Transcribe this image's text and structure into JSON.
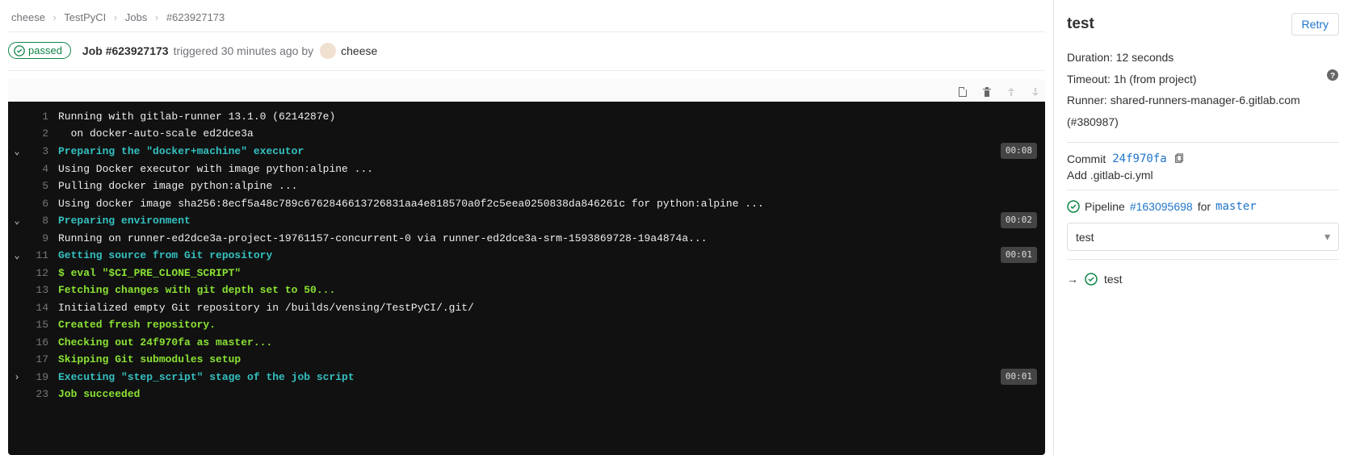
{
  "breadcrumb": {
    "items": [
      {
        "label": "cheese"
      },
      {
        "label": "TestPyCI"
      },
      {
        "label": "Jobs"
      },
      {
        "label": "#623927173"
      }
    ]
  },
  "header": {
    "status": "passed",
    "job_label": "Job #623927173",
    "triggered": "triggered 30 minutes ago by",
    "user": "cheese"
  },
  "log": {
    "lines": [
      {
        "n": 1,
        "color": "white",
        "text": "Running with gitlab-runner 13.1.0 (6214287e)"
      },
      {
        "n": 2,
        "color": "white",
        "text": "  on docker-auto-scale ed2dce3a"
      },
      {
        "n": 3,
        "color": "teal",
        "text": "Preparing the \"docker+machine\" executor",
        "chev": "down",
        "dur": "00:08"
      },
      {
        "n": 4,
        "color": "white",
        "text": "Using Docker executor with image python:alpine ..."
      },
      {
        "n": 5,
        "color": "white",
        "text": "Pulling docker image python:alpine ..."
      },
      {
        "n": 6,
        "color": "white",
        "text": "Using docker image sha256:8ecf5a48c789c6762846613726831aa4e818570a0f2c5eea0250838da846261c for python:alpine ..."
      },
      {
        "n": 8,
        "color": "teal",
        "text": "Preparing environment",
        "chev": "down",
        "dur": "00:02"
      },
      {
        "n": 9,
        "color": "white",
        "text": "Running on runner-ed2dce3a-project-19761157-concurrent-0 via runner-ed2dce3a-srm-1593869728-19a4874a..."
      },
      {
        "n": 11,
        "color": "teal",
        "text": "Getting source from Git repository",
        "chev": "down",
        "dur": "00:01"
      },
      {
        "n": 12,
        "color": "lime",
        "text": "$ eval \"$CI_PRE_CLONE_SCRIPT\""
      },
      {
        "n": 13,
        "color": "lime",
        "text": "Fetching changes with git depth set to 50..."
      },
      {
        "n": 14,
        "color": "white",
        "text": "Initialized empty Git repository in /builds/vensing/TestPyCI/.git/"
      },
      {
        "n": 15,
        "color": "lime",
        "text": "Created fresh repository."
      },
      {
        "n": 16,
        "color": "lime",
        "text": "Checking out 24f970fa as master..."
      },
      {
        "n": 17,
        "color": "lime",
        "text": "Skipping Git submodules setup"
      },
      {
        "n": 19,
        "color": "teal",
        "text": "Executing \"step_script\" stage of the job script",
        "chev": "right",
        "dur": "00:01"
      },
      {
        "n": 23,
        "color": "lime",
        "text": "Job succeeded"
      }
    ]
  },
  "side": {
    "title": "test",
    "retry": "Retry",
    "duration_label": "Duration:",
    "duration_value": "12 seconds",
    "timeout_label": "Timeout:",
    "timeout_value": "1h (from project)",
    "runner_label": "Runner:",
    "runner_value": "shared-runners-manager-6.gitlab.com (#380987)",
    "commit_label": "Commit",
    "commit_sha": "24f970fa",
    "commit_msg": "Add .gitlab-ci.yml",
    "pipeline_label": "Pipeline",
    "pipeline_id": "#163095698",
    "pipeline_for": "for",
    "pipeline_branch": "master",
    "stage_select": "test",
    "current_job": "test"
  }
}
